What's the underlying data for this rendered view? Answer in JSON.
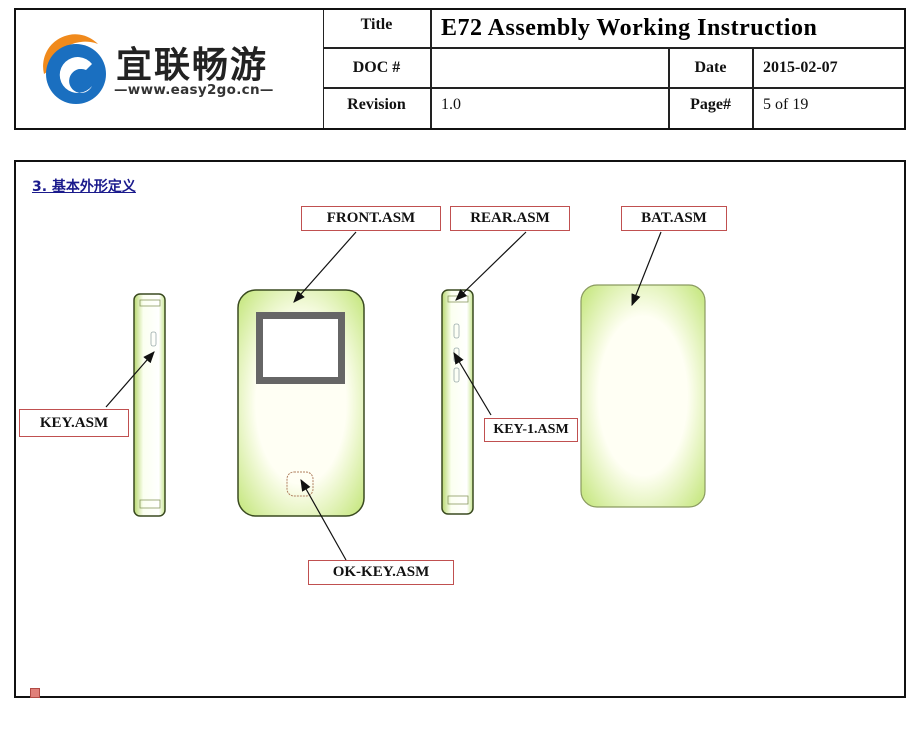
{
  "header": {
    "logo": {
      "brand_cn": "宜联畅游",
      "url": "—www.easy2go.cn—",
      "colors": {
        "orange": "#f08a1c",
        "blue": "#1a6fc0"
      }
    },
    "title_label": "Title",
    "title_value": "E72  Assembly  Working  Instruction",
    "doc_label": "DOC #",
    "doc_value": "",
    "date_label": "Date",
    "date_value": "2015-02-07",
    "revision_label": "Revision",
    "revision_value": "1.0",
    "page_label": "Page#",
    "page_value": "5  of  19"
  },
  "content": {
    "section_title": "3. 基本外形定义",
    "callouts": {
      "front": "FRONT.ASM",
      "rear": "REAR.ASM",
      "bat": "BAT.ASM",
      "key": "KEY.ASM",
      "key1": "KEY-1.ASM",
      "okkey": "OK-KEY.ASM"
    },
    "colors": {
      "part_fill": "#d8f0a0",
      "callout_border": "#c05050",
      "screen": "#666666"
    }
  }
}
